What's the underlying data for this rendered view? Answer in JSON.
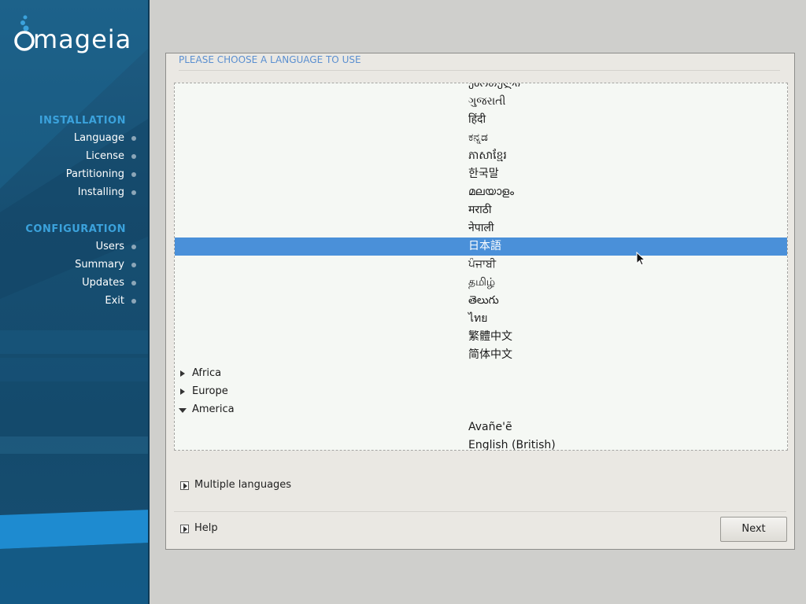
{
  "sidebar": {
    "logo_text": "mageia",
    "installation_title": "INSTALLATION",
    "installation_items": [
      "Language",
      "License",
      "Partitioning",
      "Installing"
    ],
    "configuration_title": "CONFIGURATION",
    "configuration_items": [
      "Users",
      "Summary",
      "Updates",
      "Exit"
    ],
    "icons": {
      "logo": "mageia-cauldron-icon",
      "step": "step-dot-icon"
    },
    "colors": {
      "background": "#174f72",
      "section": "#3ba2dc"
    }
  },
  "dialog": {
    "title": "PLEASE CHOOSE A LANGUAGE TO USE",
    "languages": [
      "ქართული",
      "ગુજરાતી",
      "हिंदी",
      "ಕನ್ನಡ",
      "ភាសាខ្មែរ",
      "한국말",
      "മലയാളം",
      "मराठी",
      "नेपाली",
      "日本語",
      "ਪੰਜਾਬੀ",
      "தமிழ்",
      "తెలుగు",
      "ไทย",
      "繁體中文",
      "简体中文"
    ],
    "selected_language": "日本語",
    "regions": [
      {
        "label": "Africa",
        "expanded": false
      },
      {
        "label": "Europe",
        "expanded": false
      },
      {
        "label": "America",
        "expanded": true
      }
    ],
    "america_languages": [
      "Avañe'ẽ",
      "English (British)"
    ],
    "multiple_languages_label": "Multiple languages",
    "help_label": "Help",
    "next_label": "Next",
    "colors": {
      "selection": "#4a90d9",
      "title": "#5b8fd0"
    }
  }
}
